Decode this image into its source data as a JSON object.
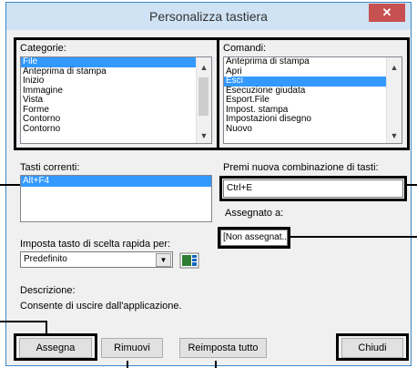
{
  "window": {
    "title": "Personalizza tastiera",
    "close_glyph": "✕"
  },
  "categories": {
    "label": "Categorie:",
    "items": [
      "File",
      "Anteprima di stampa",
      "Inizio",
      "Immagine",
      "Vista",
      "Forme",
      "Contorno",
      "Contorno"
    ],
    "selected": "File"
  },
  "commands": {
    "label": "Comandi:",
    "items": [
      "Anteprima di stampa",
      "Apri",
      "Esci",
      "Esecuzione giudata",
      "Esport.File",
      "Impost. stampa",
      "Impostazioni disegno",
      "Nuovo"
    ],
    "selected": "Esci"
  },
  "current_keys": {
    "label": "Tasti correnti:",
    "items": [
      "Alt+F4"
    ]
  },
  "new_combo": {
    "label": "Premi nuova combinazione di tasti:",
    "value": "Ctrl+E"
  },
  "assigned": {
    "label": "Assegnato a:",
    "value": "[Non assegnat..]"
  },
  "shortcut_set": {
    "label": "Imposta tasto di scelta rapida per:",
    "value": "Predefinito"
  },
  "description": {
    "label": "Descrizione:",
    "text": "Consente di uscire dall'applicazione."
  },
  "buttons": {
    "assign": "Assegna",
    "remove": "Rimuovi",
    "reset_all": "Reimposta tutto",
    "close": "Chiudi"
  },
  "icons": {
    "grid": "grid-icon"
  },
  "colors": {
    "selection": "#3399ff",
    "close": "#c75050",
    "titlebar": "#cfe3f5"
  }
}
